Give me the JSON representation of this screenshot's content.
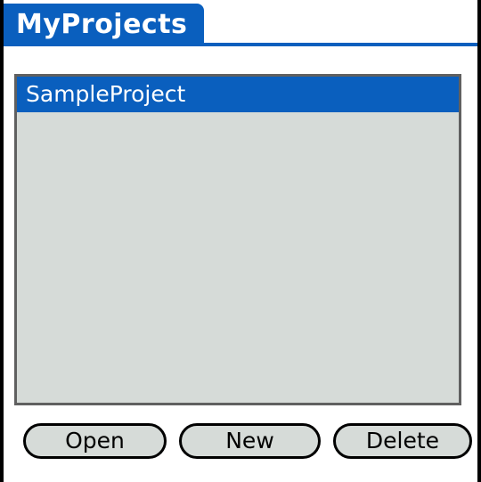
{
  "app": {
    "title": "MyProjects"
  },
  "projects_list": {
    "items": [
      {
        "label": "SampleProject",
        "selected": true
      }
    ]
  },
  "buttons": {
    "open_label": "Open",
    "new_label": "New",
    "delete_label": "Delete"
  },
  "colors": {
    "accent": "#0a5fbe",
    "list_background": "#d6dbd8",
    "list_border": "#606060",
    "frame": "#000000"
  }
}
